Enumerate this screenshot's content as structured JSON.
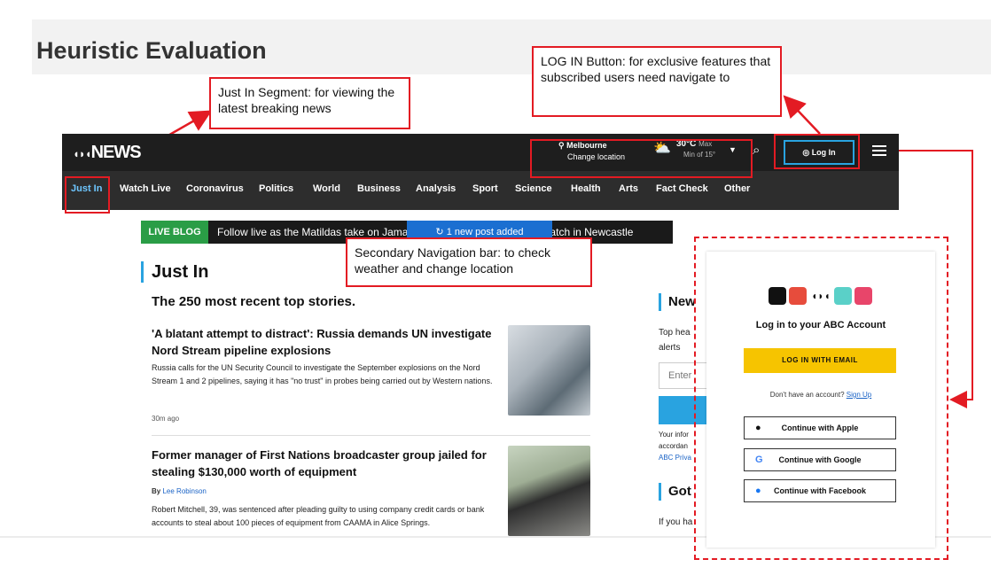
{
  "page_title": "Heuristic Evaluation",
  "callouts": {
    "login": "LOG IN Button: for exclusive features that subscribed users need navigate to",
    "justin": "Just In Segment: for viewing the latest breaking news",
    "secondary": "Secondary Navigation bar: to check weather and change location"
  },
  "site": {
    "logo": "NEWS",
    "location_city": "Melbourne",
    "location_action": "Change location",
    "temp_max": "30°C",
    "temp_max_label": "Max",
    "temp_min": "Min of 15°",
    "login_label": "Log In",
    "nav": [
      "Just In",
      "Watch Live",
      "Coronavirus",
      "Politics",
      "World",
      "Business",
      "Analysis",
      "Sport",
      "Science",
      "Health",
      "Arts",
      "Fact Check",
      "Other"
    ],
    "live_tag": "LIVE BLOG",
    "live_text": "Follow live as the Matildas take on Jama",
    "live_text_end": "match in Newcastle",
    "live_button": "1 new post added",
    "section_title": "Just In",
    "section_subtitle": "The 250 most recent top stories.",
    "stories": [
      {
        "title": "'A blatant attempt to distract': Russia demands UN investigate Nord Stream pipeline explosions",
        "body": "Russia calls for the UN Security Council to investigate the September explosions on the Nord Stream 1 and 2 pipelines, saying it has \"no trust\" in probes being carried out by Western nations.",
        "meta": "30m ago"
      },
      {
        "title": "Former manager of First Nations broadcaster group jailed for stealing $130,000 worth of equipment",
        "byline_prefix": "By",
        "byline_name": "Lee Robinson",
        "body": "Robert Mitchell, 39, was sentenced after pleading guilty to using company credit cards or bank accounts to steal about 100 pieces of equipment from CAAMA in Alice Springs."
      }
    ],
    "sidebar": {
      "heading": "New",
      "text1": "Top hea",
      "text2": "alerts",
      "input_placeholder": "Enter",
      "small1": "Your infor",
      "small2": "accordan",
      "small3": "ABC Priva",
      "heading2": "Got",
      "text3": "If you ha"
    }
  },
  "login_modal": {
    "title": "Log in to your ABC Account",
    "email_button": "LOG IN WITH EMAIL",
    "no_account": "Don't have an account?",
    "signup": "Sign Up",
    "apple": "Continue with Apple",
    "google": "Continue with Google",
    "facebook": "Continue with Facebook"
  },
  "colors": {
    "highlight": "#e31b23",
    "accent_blue": "#29a3e0",
    "email_button": "#f6c400",
    "live_green": "#2a9d46"
  }
}
